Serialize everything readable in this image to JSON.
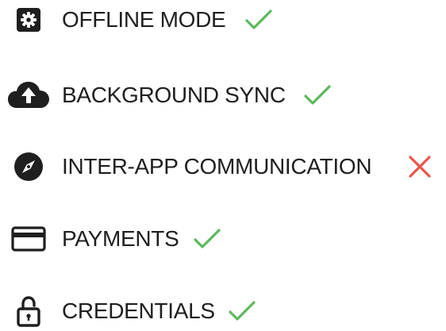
{
  "features": [
    {
      "label": "OFFLINE MODE",
      "icon": "gear-icon",
      "status": "supported"
    },
    {
      "label": "BACKGROUND SYNC",
      "icon": "cloud-upload-icon",
      "status": "supported"
    },
    {
      "label": "INTER-APP COMMUNICATION",
      "icon": "compass-icon",
      "status": "unsupported"
    },
    {
      "label": "PAYMENTS",
      "icon": "credit-card-icon",
      "status": "supported"
    },
    {
      "label": "CREDENTIALS",
      "icon": "lock-icon",
      "status": "supported"
    }
  ],
  "colors": {
    "text": "#1f1f1f",
    "icon": "#1f1f1f",
    "supported": "#5cb85c",
    "unsupported": "#e8564a"
  }
}
